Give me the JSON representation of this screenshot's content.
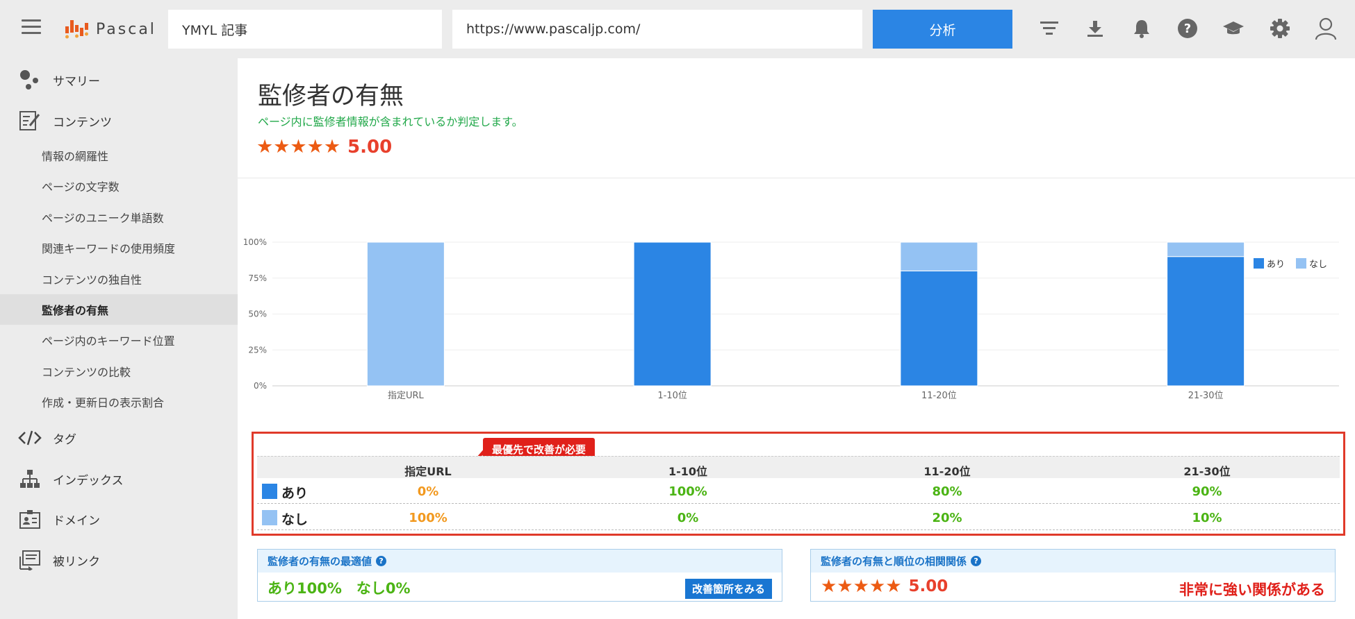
{
  "header": {
    "logo_text": "Pascal",
    "keyword_value": "YMYL 記事",
    "url_value": "https://www.pascaljp.com/",
    "analyze_label": "分析",
    "icons": [
      "filter-icon",
      "download-icon",
      "bell-icon",
      "help-icon",
      "graduation-cap-icon",
      "gear-icon",
      "user-icon"
    ]
  },
  "sidebar": {
    "main_items": [
      {
        "label": "サマリー",
        "icon": "summary-icon"
      },
      {
        "label": "コンテンツ",
        "icon": "content-icon"
      },
      {
        "label": "タグ",
        "icon": "code-icon"
      },
      {
        "label": "インデックス",
        "icon": "sitemap-icon"
      },
      {
        "label": "ドメイン",
        "icon": "id-card-icon"
      },
      {
        "label": "被リンク",
        "icon": "backlink-icon"
      }
    ],
    "sub_items": [
      {
        "label": "情報の網羅性"
      },
      {
        "label": "ページの文字数"
      },
      {
        "label": "ページのユニーク単語数"
      },
      {
        "label": "関連キーワードの使用頻度"
      },
      {
        "label": "コンテンツの独自性"
      },
      {
        "label": "監修者の有無",
        "active": true
      },
      {
        "label": "ページ内のキーワード位置"
      },
      {
        "label": "コンテンツの比較"
      },
      {
        "label": "作成・更新日の表示割合"
      }
    ]
  },
  "main": {
    "title": "監修者の有無",
    "subtitle": "ページ内に監修者情報が含まれているか判定します。",
    "stars": "★★★★★",
    "score": "5.00"
  },
  "chart_data": {
    "type": "bar",
    "stacked": true,
    "categories": [
      "指定URL",
      "1-10位",
      "11-20位",
      "21-30位"
    ],
    "series": [
      {
        "name": "あり",
        "values": [
          0,
          100,
          80,
          90
        ],
        "color": "#2b85e4"
      },
      {
        "name": "なし",
        "values": [
          100,
          0,
          20,
          10
        ],
        "color": "#94c2f3"
      }
    ],
    "y_ticks": [
      "0%",
      "25%",
      "50%",
      "75%",
      "100%"
    ],
    "ylim": [
      0,
      100
    ],
    "legend": "top-right",
    "grid": true
  },
  "table": {
    "callout": "最優先で改善が必要",
    "headers": [
      "指定URL",
      "1-10位",
      "11-20位",
      "21-30位"
    ],
    "rows": [
      {
        "label": "あり",
        "color": "#2b85e4",
        "values": [
          "0%",
          "100%",
          "80%",
          "90%"
        ],
        "value_colors": [
          "#f2991f",
          "#4bb414",
          "#4bb414",
          "#4bb414"
        ]
      },
      {
        "label": "なし",
        "color": "#94c2f3",
        "values": [
          "100%",
          "0%",
          "20%",
          "10%"
        ],
        "value_colors": [
          "#f2991f",
          "#4bb414",
          "#4bb414",
          "#4bb414"
        ]
      }
    ]
  },
  "panels": {
    "optimal": {
      "title": "監修者の有無の最適値",
      "value": "あり100%　なし0%",
      "button": "改善箇所をみる"
    },
    "correlation": {
      "title": "監修者の有無と順位の相関関係",
      "stars": "★★★★★",
      "score": "5.00",
      "relation": "非常に強い関係がある"
    }
  }
}
